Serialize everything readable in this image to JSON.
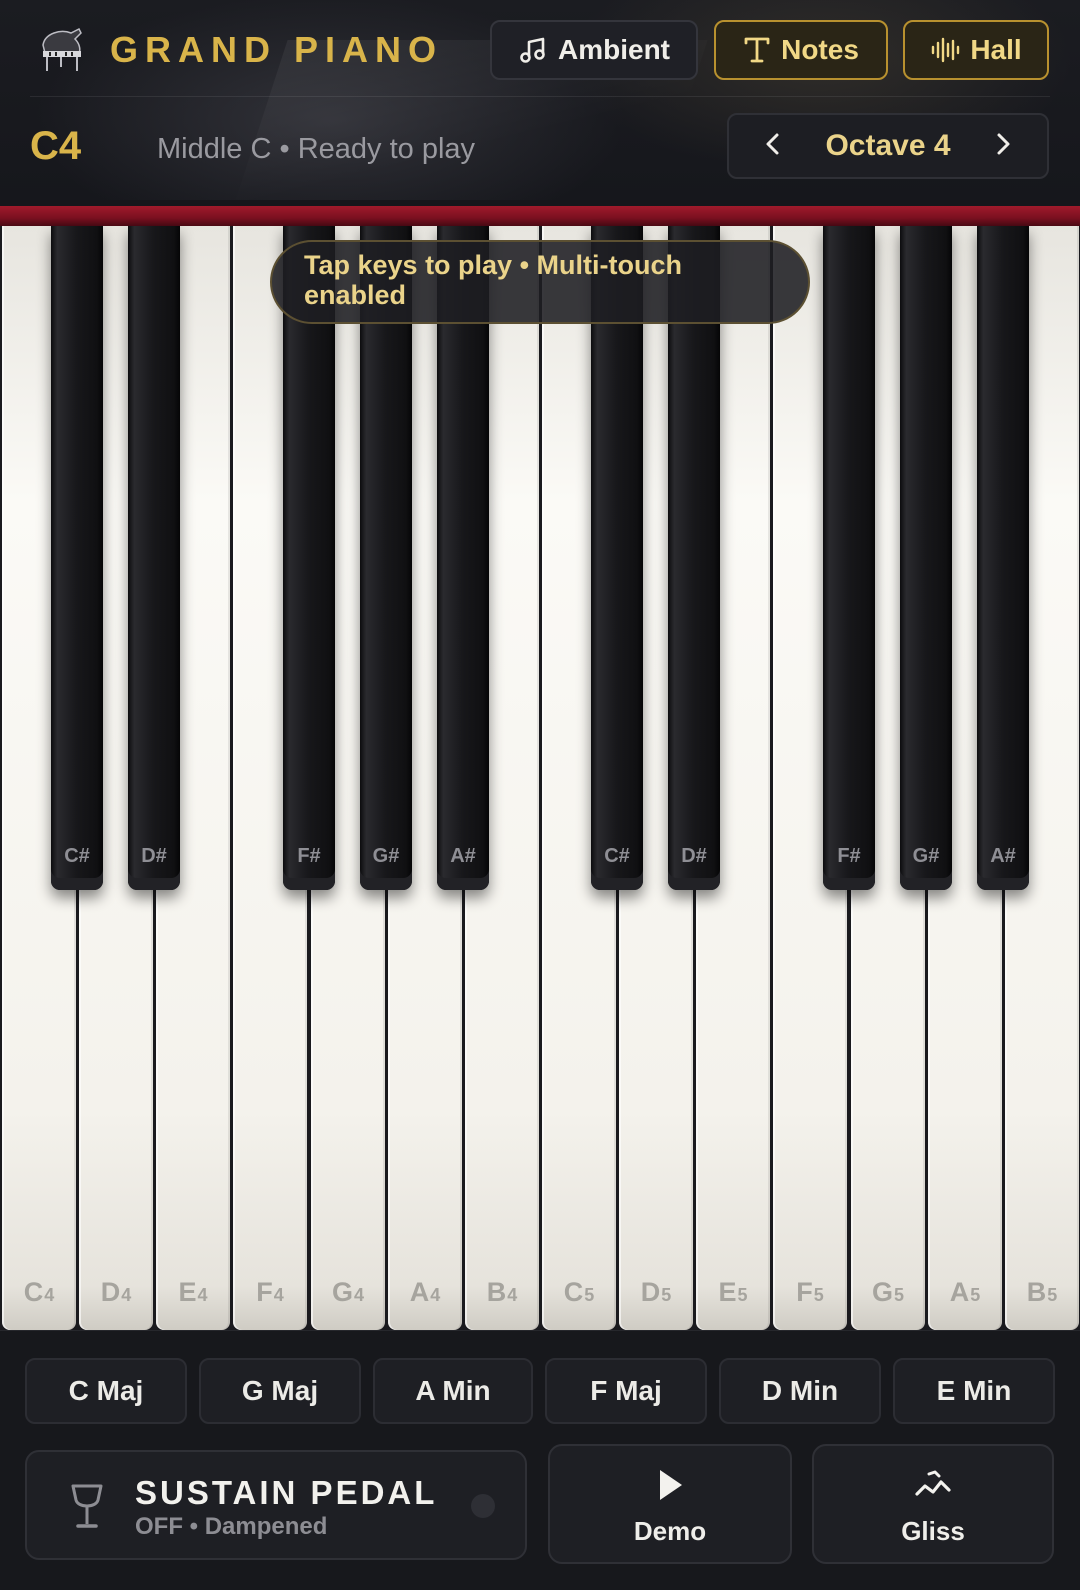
{
  "header": {
    "title": "GRAND PIANO",
    "buttons": {
      "ambient": "Ambient",
      "notes": "Notes",
      "hall": "Hall"
    }
  },
  "status": {
    "current_note": "C4",
    "description": "Middle C • Ready to play",
    "octave_label": "Octave 4"
  },
  "hint": "Tap keys to play • Multi-touch enabled",
  "white_keys": [
    {
      "note": "C",
      "octave": "4"
    },
    {
      "note": "D",
      "octave": "4"
    },
    {
      "note": "E",
      "octave": "4"
    },
    {
      "note": "F",
      "octave": "4"
    },
    {
      "note": "G",
      "octave": "4"
    },
    {
      "note": "A",
      "octave": "4"
    },
    {
      "note": "B",
      "octave": "4"
    },
    {
      "note": "C",
      "octave": "5"
    },
    {
      "note": "D",
      "octave": "5"
    },
    {
      "note": "E",
      "octave": "5"
    },
    {
      "note": "F",
      "octave": "5"
    },
    {
      "note": "G",
      "octave": "5"
    },
    {
      "note": "A",
      "octave": "5"
    },
    {
      "note": "B",
      "octave": "5"
    }
  ],
  "black_keys": [
    "C#",
    "D#",
    "F#",
    "G#",
    "A#",
    "C#",
    "D#",
    "F#",
    "G#",
    "A#"
  ],
  "chords": [
    "C Maj",
    "G Maj",
    "A Min",
    "F Maj",
    "D Min",
    "E Min"
  ],
  "sustain": {
    "title": "SUSTAIN PEDAL",
    "state": "OFF • Dampened"
  },
  "actions": {
    "demo": "Demo",
    "gliss": "Gliss"
  },
  "icons": {
    "logo": "grand-piano-icon",
    "ambient": "music-note-icon",
    "notes": "text-t-icon",
    "hall": "waveform-icon",
    "prev": "chevron-left-icon",
    "next": "chevron-right-icon",
    "sustain": "goblet-icon",
    "demo": "play-icon",
    "gliss": "glissando-icon"
  },
  "colors": {
    "accent": "#d9b44a",
    "felt": "#a01a2b",
    "background": "#15161b"
  }
}
